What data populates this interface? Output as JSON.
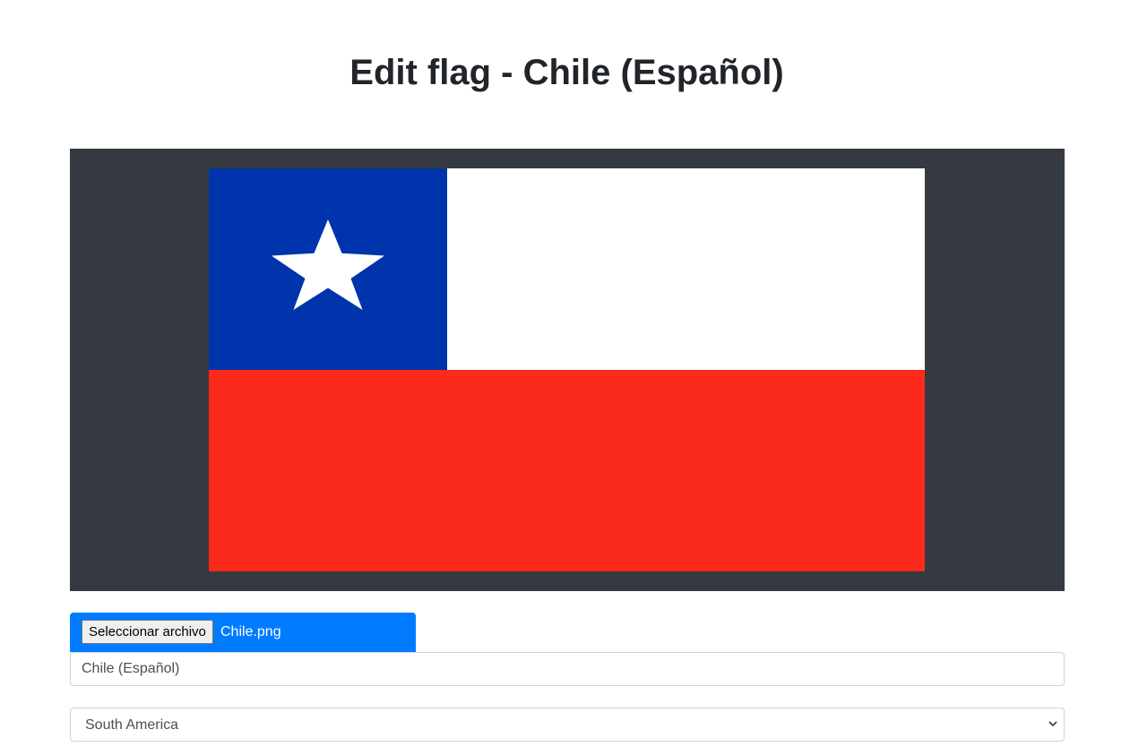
{
  "page": {
    "title": "Edit flag - Chile (Español)"
  },
  "preview": {
    "flag_icon": "chile-flag",
    "colors": {
      "panel_background": "#343a40",
      "flag_blue": "#0034ad",
      "flag_white": "#ffffff",
      "flag_red": "#fc2a1a"
    }
  },
  "file_upload": {
    "button_label": "Seleccionar archivo",
    "file_name": "Chile.png",
    "accent_color": "#007bff"
  },
  "form": {
    "name_value": "Chile (Español)",
    "region_selected": "South America"
  }
}
